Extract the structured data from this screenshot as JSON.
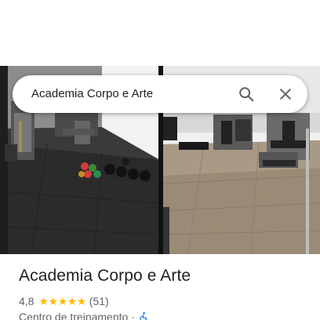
{
  "search": {
    "query": "Academia Corpo e Arte",
    "search_icon": "search-icon",
    "close_icon": "close-icon"
  },
  "place": {
    "name": "Academia Corpo e Arte",
    "rating": "4,8",
    "rating_stars": 5,
    "review_count": "(51)",
    "category": "Centro de treinamento",
    "separator": "·",
    "accessibility_icon": "wheelchair-accessible-icon"
  },
  "photos": [
    {
      "description_icon": "gym-photo-left"
    },
    {
      "description_icon": "gym-photo-right"
    }
  ],
  "colors": {
    "star": "#fbbc04",
    "accessibility": "#1a73e8",
    "text_primary": "#202124",
    "text_secondary": "#5f6368"
  }
}
